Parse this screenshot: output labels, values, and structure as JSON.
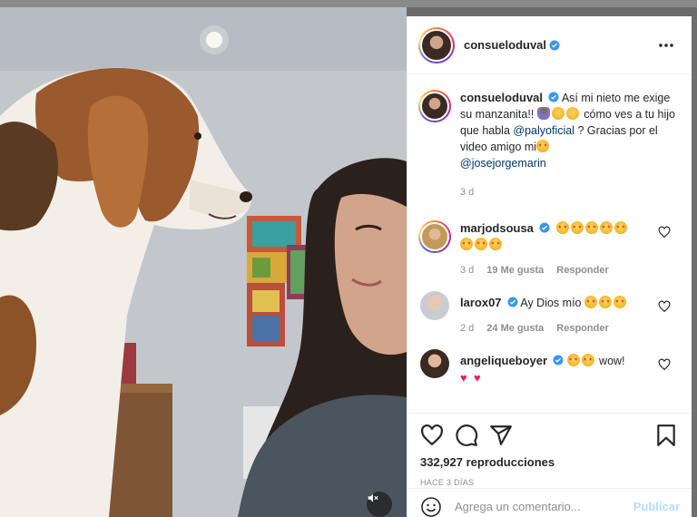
{
  "post": {
    "author": "consueloduval",
    "more_label": "⋯"
  },
  "caption": {
    "username": "consueloduval",
    "text_1": "Así mi nieto me exige su manzanita!!",
    "text_2": "cómo ves a tu hijo que habla",
    "mention_1": "@palyoficial",
    "text_3": "? Gracias por el video amigo mi",
    "mention_2": "@josejorgemarin",
    "time": "3 d"
  },
  "comments": [
    {
      "username": "marjodsousa",
      "time": "3 d",
      "likes": "19 Me gusta",
      "reply": "Responder"
    },
    {
      "username": "larox07",
      "text": "Ay Dios mío",
      "time": "2 d",
      "likes": "24 Me gusta",
      "reply": "Responder"
    },
    {
      "username": "angeliqueboyer",
      "text": "wow!"
    }
  ],
  "stats": {
    "views": "332,927 reproducciones",
    "ago": "HACE 3 DÍAS"
  },
  "add_comment": {
    "placeholder": "Agrega un comentario...",
    "publish": "Publicar"
  },
  "colors": {
    "verified": "#3897f0",
    "link": "#00376b",
    "publish_disabled": "#b2dffc"
  },
  "icons": [
    "heart-icon",
    "comment-icon",
    "share-icon",
    "bookmark-icon",
    "smile-icon",
    "mute-icon",
    "verified-icon",
    "more-icon"
  ]
}
